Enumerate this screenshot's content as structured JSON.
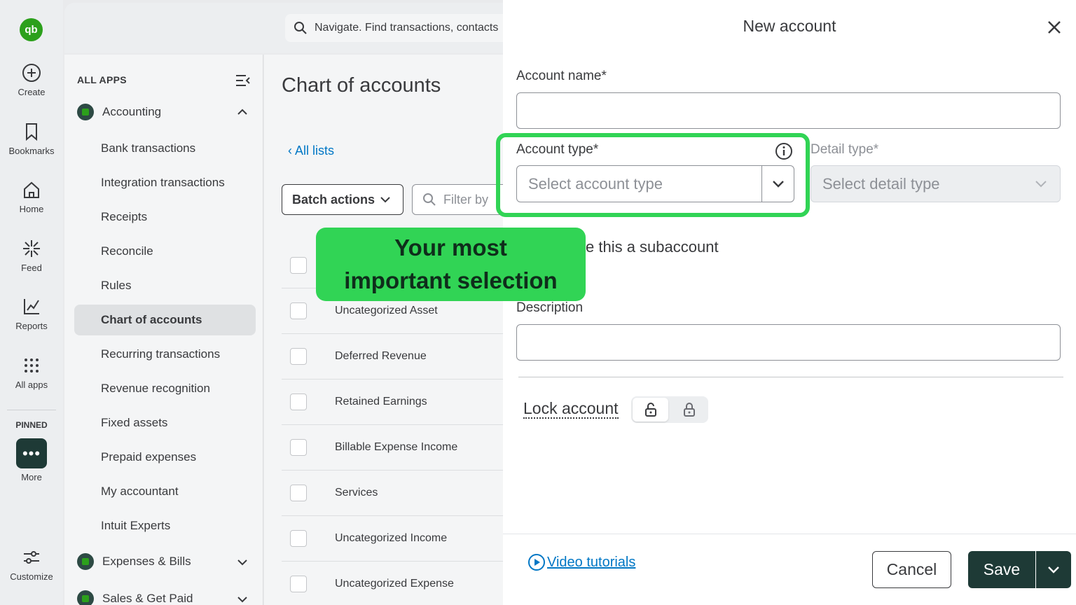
{
  "rail": {
    "logo": "qb",
    "items": [
      {
        "label": "Create",
        "icon": "plus-circle-icon"
      },
      {
        "label": "Bookmarks",
        "icon": "bookmark-icon"
      },
      {
        "label": "Home",
        "icon": "home-icon"
      },
      {
        "label": "Feed",
        "icon": "feed-icon"
      },
      {
        "label": "Reports",
        "icon": "reports-icon"
      },
      {
        "label": "All apps",
        "icon": "grid-icon"
      }
    ],
    "pinned_label": "PINNED",
    "more_label": "More",
    "customize_label": "Customize"
  },
  "topbar": {
    "search_placeholder": "Navigate. Find transactions, contacts"
  },
  "appnav": {
    "all_apps": "ALL APPS",
    "groups": [
      {
        "label": "Accounting"
      },
      {
        "label": "Expenses & Bills"
      },
      {
        "label": "Sales & Get Paid"
      }
    ],
    "items": [
      "Bank transactions",
      "Integration transactions",
      "Receipts",
      "Reconcile",
      "Rules",
      "Chart of accounts",
      "Recurring transactions",
      "Revenue recognition",
      "Fixed assets",
      "Prepaid expenses",
      "My accountant",
      "Intuit Experts"
    ],
    "active_item": "Chart of accounts"
  },
  "main": {
    "title": "Chart of accounts",
    "all_lists": "All lists",
    "batch_actions": "Batch actions",
    "filter_placeholder": "Filter by",
    "rows": [
      "Uncategorized Asset",
      "Deferred Revenue",
      "Retained Earnings",
      "Billable Expense Income",
      "Services",
      "Uncategorized Income",
      "Uncategorized Expense"
    ]
  },
  "drawer": {
    "title": "New account",
    "account_name_label": "Account name*",
    "account_name_value": "",
    "account_type_label": "Account type*",
    "account_type_placeholder": "Select account type",
    "detail_type_label": "Detail type*",
    "detail_type_placeholder": "Select detail type",
    "subaccount_text": "e this a subaccount",
    "description_label": "Description",
    "description_value": "",
    "lock_label": "Lock account",
    "video_tutorials": "Video tutorials",
    "cancel": "Cancel",
    "save": "Save"
  },
  "callout": {
    "line1": "Your most",
    "line2": "important selection",
    "color": "#31d455"
  },
  "colors": {
    "brand_green": "#2ca01c",
    "dark_teal": "#1e3a36",
    "link_blue": "#0077c5"
  }
}
